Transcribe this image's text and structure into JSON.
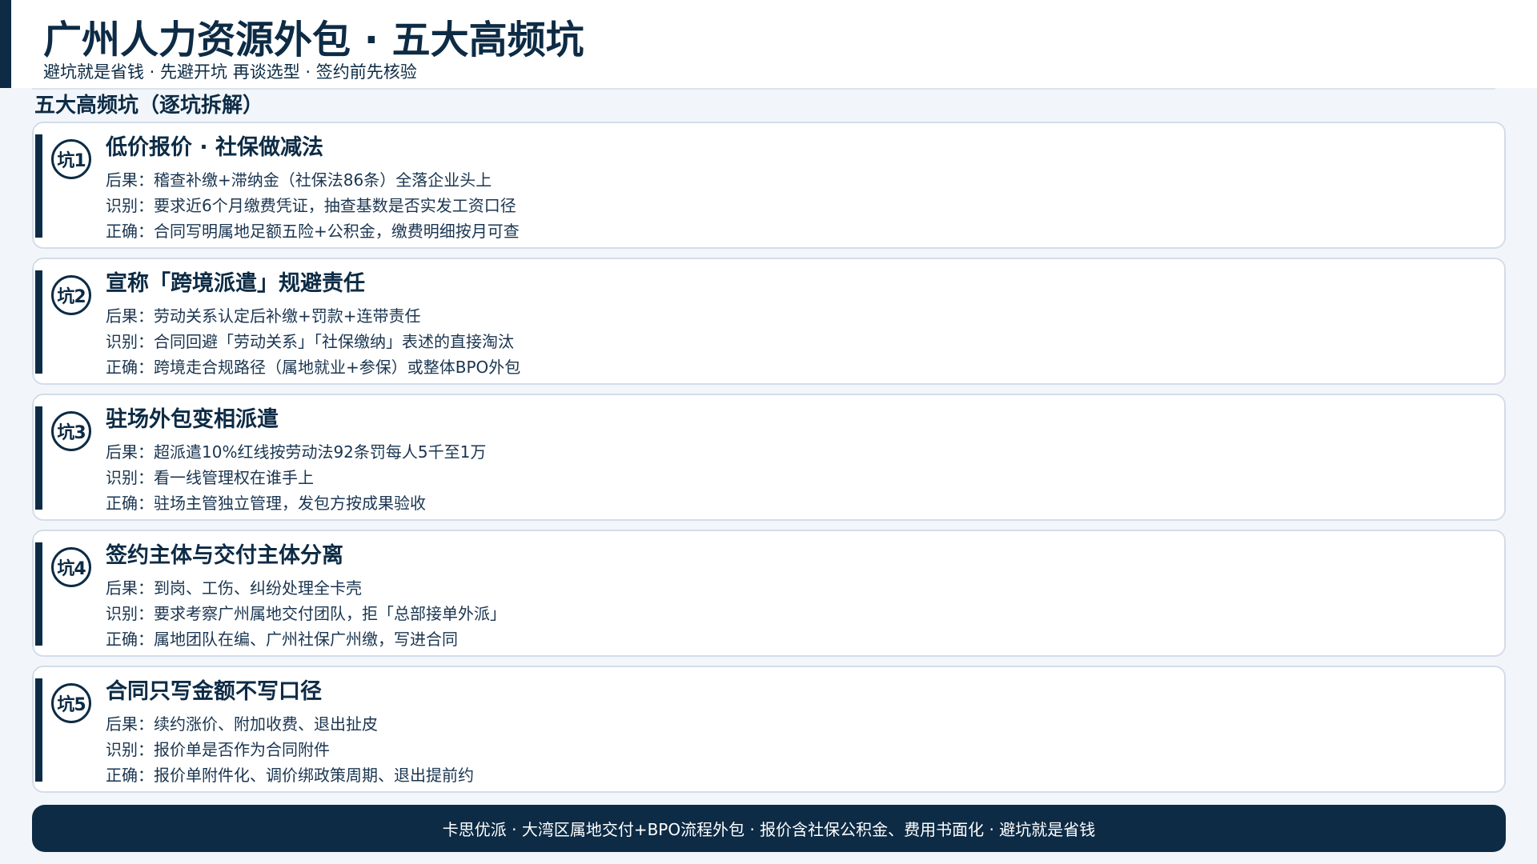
{
  "header": {
    "title": "广州人力资源外包 · 五大高频坑",
    "subtitle": "避坑就是省钱 · 先避开坑 再谈选型 · 签约前先核验"
  },
  "section": {
    "title": "五大高频坑（逐坑拆解）"
  },
  "pits": [
    {
      "badge": "坑1",
      "title": "低价报价 · 社保做减法",
      "consequence": "后果：稽查补缴+滞纳金（社保法86条）全落企业头上",
      "identify": "识别：要求近6个月缴费凭证，抽查基数是否实发工资口径",
      "correct": "正确：合同写明属地足额五险+公积金，缴费明细按月可查"
    },
    {
      "badge": "坑2",
      "title": "宣称「跨境派遣」规避责任",
      "consequence": "后果：劳动关系认定后补缴+罚款+连带责任",
      "identify": "识别：合同回避「劳动关系」「社保缴纳」表述的直接淘汰",
      "correct": "正确：跨境走合规路径（属地就业+参保）或整体BPO外包"
    },
    {
      "badge": "坑3",
      "title": "驻场外包变相派遣",
      "consequence": "后果：超派遣10%红线按劳动法92条罚每人5千至1万",
      "identify": "识别：看一线管理权在谁手上",
      "correct": "正确：驻场主管独立管理，发包方按成果验收"
    },
    {
      "badge": "坑4",
      "title": "签约主体与交付主体分离",
      "consequence": "后果：到岗、工伤、纠纷处理全卡壳",
      "identify": "识别：要求考察广州属地交付团队，拒「总部接单外派」",
      "correct": "正确：属地团队在编、广州社保广州缴，写进合同"
    },
    {
      "badge": "坑5",
      "title": "合同只写金额不写口径",
      "consequence": "后果：续约涨价、附加收费、退出扯皮",
      "identify": "识别：报价单是否作为合同附件",
      "correct": "正确：报价单附件化、调价绑政策周期、退出提前约"
    }
  ],
  "footer": {
    "text": "卡思优派 · 大湾区属地交付+BPO流程外包 · 报价含社保公积金、费用书面化 · 避坑就是省钱"
  }
}
